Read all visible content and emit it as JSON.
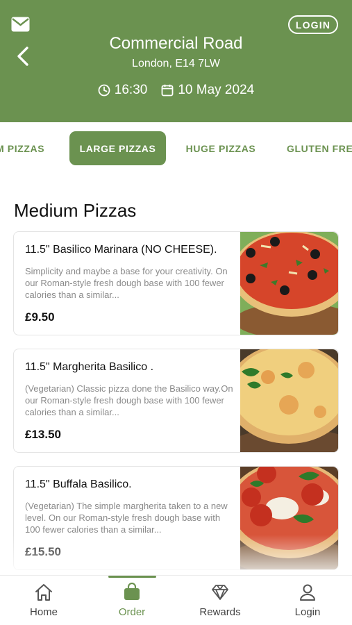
{
  "header": {
    "store_name": "Commercial Road",
    "store_address": "London, E14 7LW",
    "time": "16:30",
    "date": "10 May 2024",
    "login_label": "LOGIN",
    "icons": {
      "mail": "mail-icon",
      "back": "back-arrow-icon",
      "clock": "clock-icon",
      "calendar": "calendar-icon"
    }
  },
  "tabs": [
    {
      "label": "M PIZZAS"
    },
    {
      "label": "LARGE PIZZAS",
      "active": true
    },
    {
      "label": "HUGE PIZZAS"
    },
    {
      "label": "GLUTEN FRE"
    }
  ],
  "section_title": "Medium Pizzas",
  "products": [
    {
      "name": "11.5\" Basilico Marinara (NO CHEESE).",
      "description": "Simplicity and maybe a base for your creativity. On our Roman-style fresh dough base with 100 fewer calories than a similar...",
      "price": "£9.50"
    },
    {
      "name": "11.5\" Margherita Basilico .",
      "description": "(Vegetarian) Classic pizza done the Basilico way.On our Roman-style fresh dough base with 100 fewer calories than a similar...",
      "price": "£13.50"
    },
    {
      "name": "11.5\" Buffala Basilico.",
      "description": "(Vegetarian) The simple margherita taken to a new level. On our Roman-style fresh dough base with 100 fewer calories than a similar...",
      "price": "£15.50"
    }
  ],
  "bottom_nav": [
    {
      "label": "Home",
      "icon": "home-icon"
    },
    {
      "label": "Order",
      "icon": "shopping-bag-icon",
      "active": true
    },
    {
      "label": "Rewards",
      "icon": "diamond-icon"
    },
    {
      "label": "Login",
      "icon": "user-icon"
    }
  ],
  "colors": {
    "brand_green": "#6b9250",
    "text_dark": "#111111",
    "text_muted": "#8a8a8a"
  }
}
